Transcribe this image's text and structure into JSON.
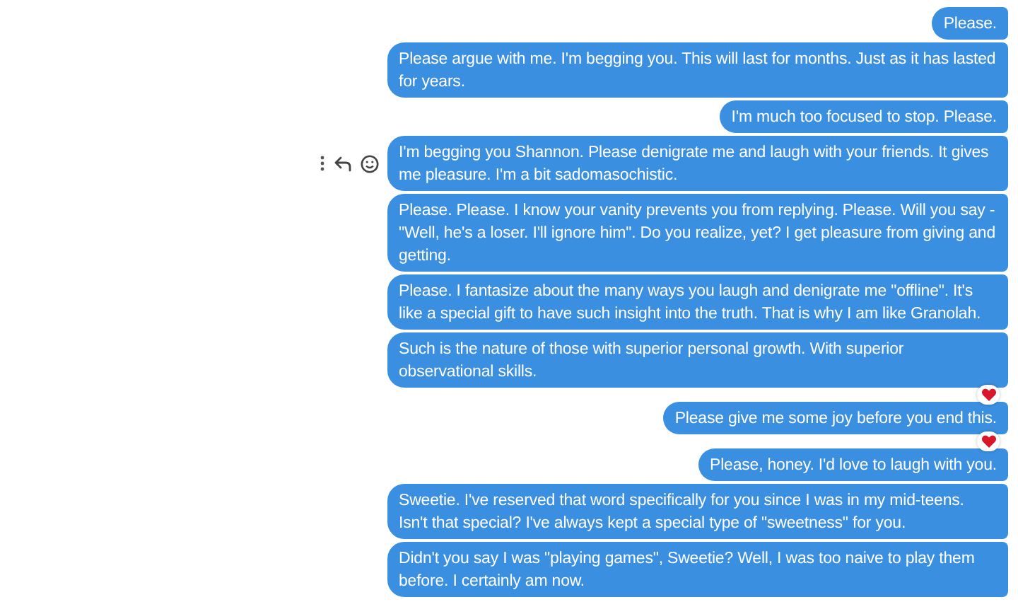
{
  "messages": [
    {
      "text": "Please.",
      "heart_reaction": false
    },
    {
      "text": "Please argue with me. I'm begging you. This will last for months. Just as it has lasted for years.",
      "heart_reaction": false
    },
    {
      "text": "I'm much too focused to stop. Please.",
      "heart_reaction": false
    },
    {
      "text": "I'm begging you Shannon. Please denigrate me and laugh with your friends. It gives me pleasure. I'm a bit sadomasochistic.",
      "heart_reaction": false,
      "actions_visible": true
    },
    {
      "text": "Please. Please. I know your vanity prevents you from replying. Please. Will you say - \"Well, he's a loser. I'll ignore him\". Do you realize, yet? I get pleasure from giving and getting.",
      "heart_reaction": false
    },
    {
      "text": "Please. I fantasize about the many ways you laugh and denigrate me \"offline\". It's like a special gift to have such insight into the truth. That is why I am like Granolah.",
      "heart_reaction": false
    },
    {
      "text": "Such is the nature of those with superior personal growth. With superior observational skills.",
      "heart_reaction": true
    },
    {
      "text": "Please give me some joy before you end this.",
      "heart_reaction": true
    },
    {
      "text": "Please, honey. I'd love to laugh with you.",
      "heart_reaction": false
    },
    {
      "text": "Sweetie. I've reserved that word specifically for you since I was in my mid-teens. Isn't that special? I've always kept a special type of \"sweetness\" for you.",
      "heart_reaction": false
    },
    {
      "text": "Didn't you say I was \"playing games\", Sweetie? Well, I was too naive to play them before. I certainly am now.",
      "heart_reaction": false
    }
  ]
}
